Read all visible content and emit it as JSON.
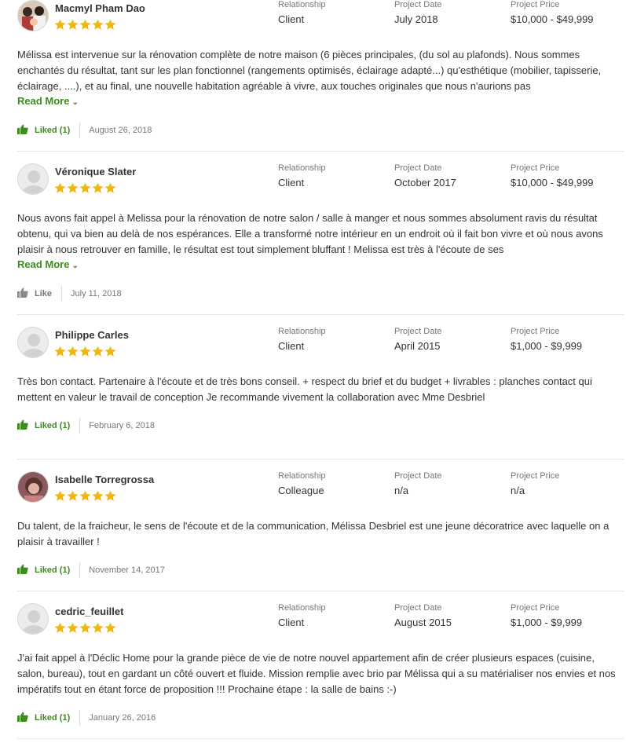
{
  "labels": {
    "relationship": "Relationship",
    "project_date": "Project Date",
    "project_price": "Project Price",
    "read_more": "Read More",
    "like": "Like"
  },
  "colors": {
    "star": "#f5b60a",
    "accent": "#3d8b1f"
  },
  "reviews": [
    {
      "name": "Macmyl Pham Dao",
      "rating": 5,
      "relationship": "Client",
      "project_date": "July 2018",
      "project_price": "$10,000 - $49,999",
      "text": "Mélissa est intervenue sur la rénovation complète de notre maison (6 pièces principales, (du sol au plafonds). Nous sommes enchantés du résultat, tant sur les plan fonctionnel (rangements optimisés, éclairage adapté...) qu'esthétique (mobilier, tapisserie, éclairage, ....), et au final, une nouvelle habitation agréable à vivre, aux touches originales que nous n'aurions pas",
      "read_more": true,
      "like_label": "Liked (1)",
      "liked": true,
      "date": "August 26, 2018"
    },
    {
      "name": "Véronique Slater",
      "rating": 5,
      "relationship": "Client",
      "project_date": "October 2017",
      "project_price": "$10,000 - $49,999",
      "text": "Nous avons fait appel à Melissa pour la rénovation de notre salon / salle à manger et nous sommes absolument ravis du résultat obtenu, qui va bien au delà de nos espérances. Elle a transformé notre intérieur en un endroit où il fait bon vivre et où nous avons plaisir à nous retrouver en famille, le résultat est tout simplement bluffant ! Melissa est très à l'écoute de ses",
      "read_more": true,
      "like_label": "Like",
      "liked": false,
      "date": "July 11, 2018"
    },
    {
      "name": "Philippe Carles",
      "rating": 5,
      "relationship": "Client",
      "project_date": "April 2015",
      "project_price": "$1,000 - $9,999",
      "text": "Très bon contact. Partenaire à l'écoute et de très bons conseil. + respect du brief et du budget + livrables : planches contact qui mettent en valeur le travail de conception Je recommande vivement la collaboration avec Mme Desbriel",
      "read_more": false,
      "like_label": "Liked (1)",
      "liked": true,
      "date": "February 6, 2018"
    },
    {
      "name": "Isabelle Torregrossa",
      "rating": 5,
      "relationship": "Colleague",
      "project_date": "n/a",
      "project_price": "n/a",
      "text": "Du talent, de la fraicheur, le sens de l'écoute et de la communication, Mélissa Desbriel est une jeune décoratrice avec laquelle on a plaisir à travailler !",
      "read_more": false,
      "like_label": "Liked (1)",
      "liked": true,
      "date": "November 14, 2017"
    },
    {
      "name": "cedric_feuillet",
      "rating": 5,
      "relationship": "Client",
      "project_date": "August 2015",
      "project_price": "$1,000 - $9,999",
      "text": "J'ai fait appel à l'Déclic Home pour la grande pièce de vie de notre nouvel appartement afin de créer plusieurs espaces (cuisine, salon, bureau), tout en gardant un côté ouvert et fluide. Mission remplie avec brio par Mélissa qui a su matérialiser nos envies et nos impératifs tout en étant force de proposition !!! Prochaine étape : la salle de bains :-)",
      "read_more": false,
      "like_label": "Liked (1)",
      "liked": true,
      "date": "January 26, 2016"
    }
  ]
}
